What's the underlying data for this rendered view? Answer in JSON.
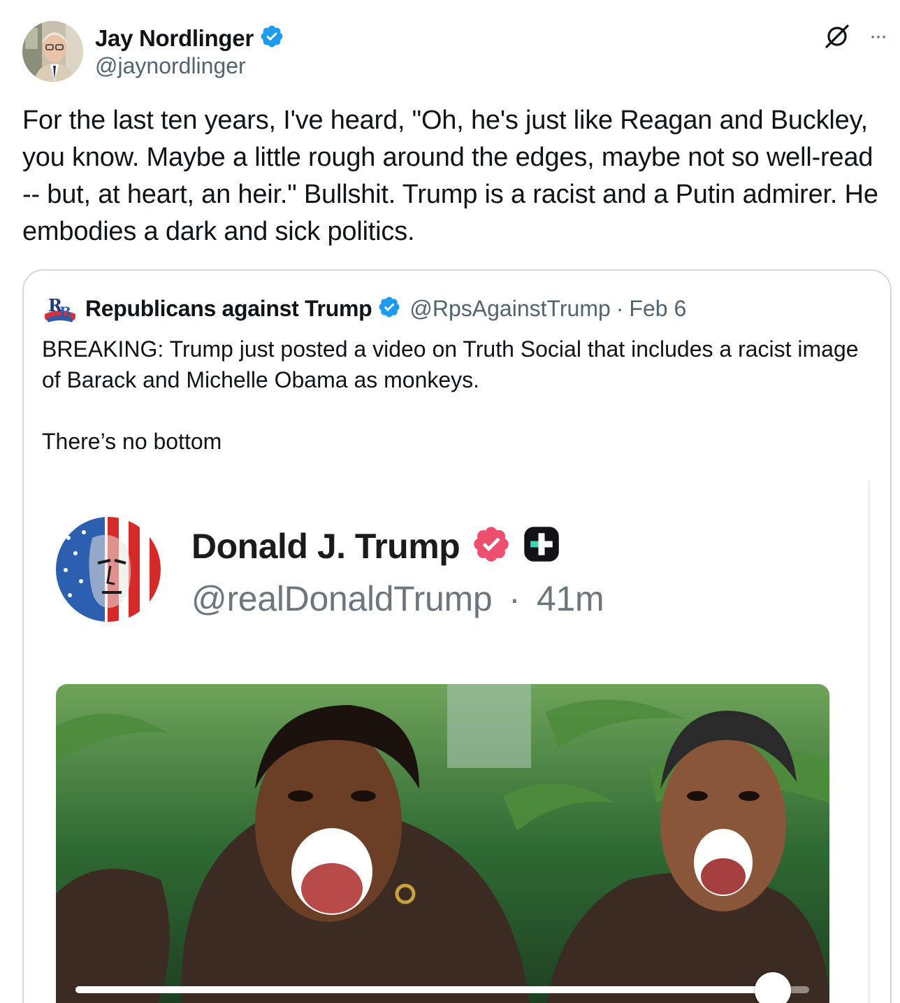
{
  "tweet": {
    "author": {
      "display_name": "Jay Nordlinger",
      "handle": "@jaynordlinger"
    },
    "text": "For the last ten years, I've heard, \"Oh, he's just like Reagan and Buckley, you know. Maybe a little rough around the edges, maybe not so well-read -- but, at heart, an heir.\" Bullshit. Trump is a racist and a Putin admirer. He embodies a dark and sick politics.",
    "icons": {
      "grok": "grok-icon",
      "more": "more-icon"
    },
    "more_label": "···"
  },
  "quoted": {
    "author": {
      "display_name": "Republicans against Trump",
      "handle": "@RpsAgainstTrump",
      "date": "Feb 6",
      "separator": "·"
    },
    "text": "BREAKING: Trump just posted a video on Truth Social that includes a racist image of Barack and Michelle Obama as monkeys.\n\nThere’s no bottom"
  },
  "embedded_post": {
    "display_name": "Donald J. Trump",
    "handle": "@realDonaldTrump",
    "separator": "·",
    "time": "41m"
  },
  "video": {
    "progress": 0.95
  },
  "colors": {
    "verified_blue": "#1d9bf0",
    "truth_badge": "#ef4f6f",
    "text_primary": "#0f1419",
    "text_secondary": "#536471",
    "border": "#cfd9de"
  }
}
